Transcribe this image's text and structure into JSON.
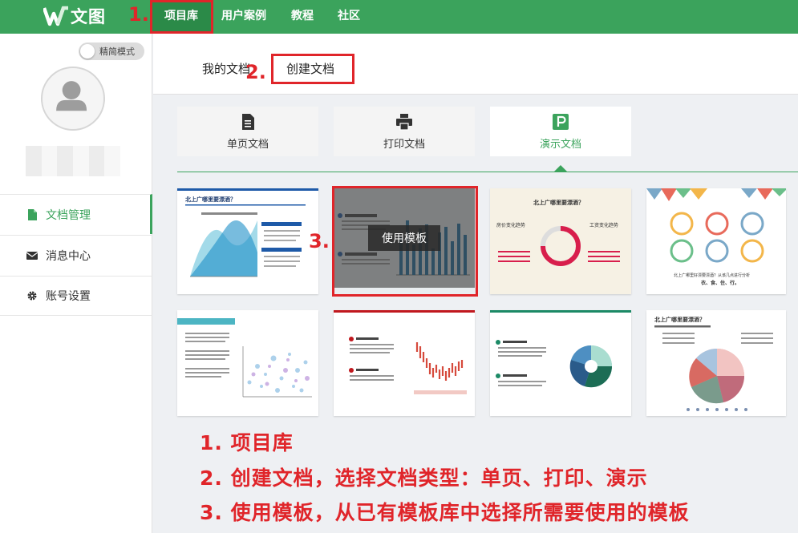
{
  "header": {
    "logo_text": "文图",
    "nav": [
      {
        "label": "项目库",
        "active": true
      },
      {
        "label": "用户案例"
      },
      {
        "label": "教程"
      },
      {
        "label": "社区"
      }
    ]
  },
  "sidebar": {
    "toggle_label": "精简模式",
    "menu": [
      {
        "label": "文档管理",
        "icon": "document-icon",
        "active": true
      },
      {
        "label": "消息中心",
        "icon": "envelope-icon"
      },
      {
        "label": "账号设置",
        "icon": "gear-icon"
      }
    ]
  },
  "tabs": [
    {
      "label": "我的文档"
    },
    {
      "label": "创建文档",
      "active": true
    }
  ],
  "doc_types": [
    {
      "label": "单页文档",
      "icon": "document-icon"
    },
    {
      "label": "打印文档",
      "icon": "printer-icon"
    },
    {
      "label": "演示文档",
      "icon": "presentation-icon",
      "active": true
    }
  ],
  "templates": {
    "hover_button": "使用模板",
    "t1_title": "北上广哪里要漂酒？",
    "t3_title": "北上广哪里要漂酒？",
    "t3_left": "房价变化趋势",
    "t3_right": "工资变化趋势",
    "t4_caption": "北上广哪里好漂要漂酒？从该几点进行分析",
    "t4_caption2": "衣、食、住、行。",
    "t8_title": "北上广哪里要漂酒？"
  },
  "annotations": {
    "step1": "1.",
    "step2": "2.",
    "step3": "3.",
    "lines": [
      "1. 项目库",
      "2. 创建文档，选择文档类型：单页、打印、演示",
      "3. 使用模板，从已有模板库中选择所需要使用的模板"
    ]
  },
  "colors": {
    "brand": "#3ba35c",
    "annotation": "#e0252a"
  }
}
